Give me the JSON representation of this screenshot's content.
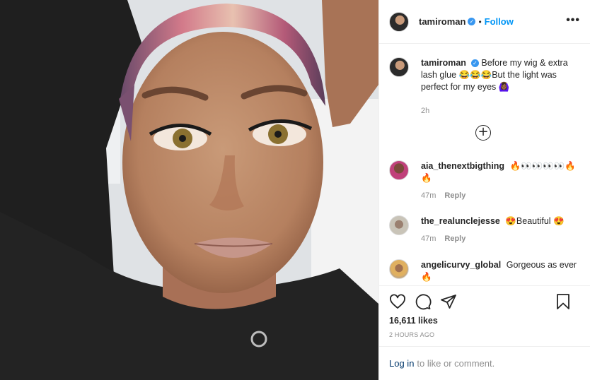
{
  "post": {
    "username": "tamiroman",
    "verified_mark": "✓",
    "dot": "•",
    "follow_label": "Follow",
    "more_label": "•••",
    "image_icon": "selfie-photo"
  },
  "caption": {
    "username": "tamiroman",
    "text": "Before my wig & extra lash glue 😂😂😂But the light was perfect for my eyes 🙆🏾‍♀️",
    "age": "2h"
  },
  "load_more": {
    "icon": "plus-circle-icon",
    "label": "+"
  },
  "comments": [
    {
      "username": "aia_thenextbigthing",
      "text": "🔥👀👀👀👀🔥🔥",
      "age": "47m",
      "reply": "Reply"
    },
    {
      "username": "the_realunclejesse",
      "text": "😍Beautiful 😍",
      "age": "47m",
      "reply": "Reply"
    },
    {
      "username": "angelicurvy_global",
      "text": "Gorgeous as ever 🔥",
      "age": "",
      "reply": ""
    }
  ],
  "stats": {
    "likes": "16,611 likes",
    "posted": "2 HOURS AGO"
  },
  "footer": {
    "login_link": "Log in",
    "rest": "to like or comment."
  },
  "colors": {
    "accent": "#0095f6",
    "verified": "#3897f0",
    "border": "#efefef",
    "muted": "#8e8e8e"
  }
}
